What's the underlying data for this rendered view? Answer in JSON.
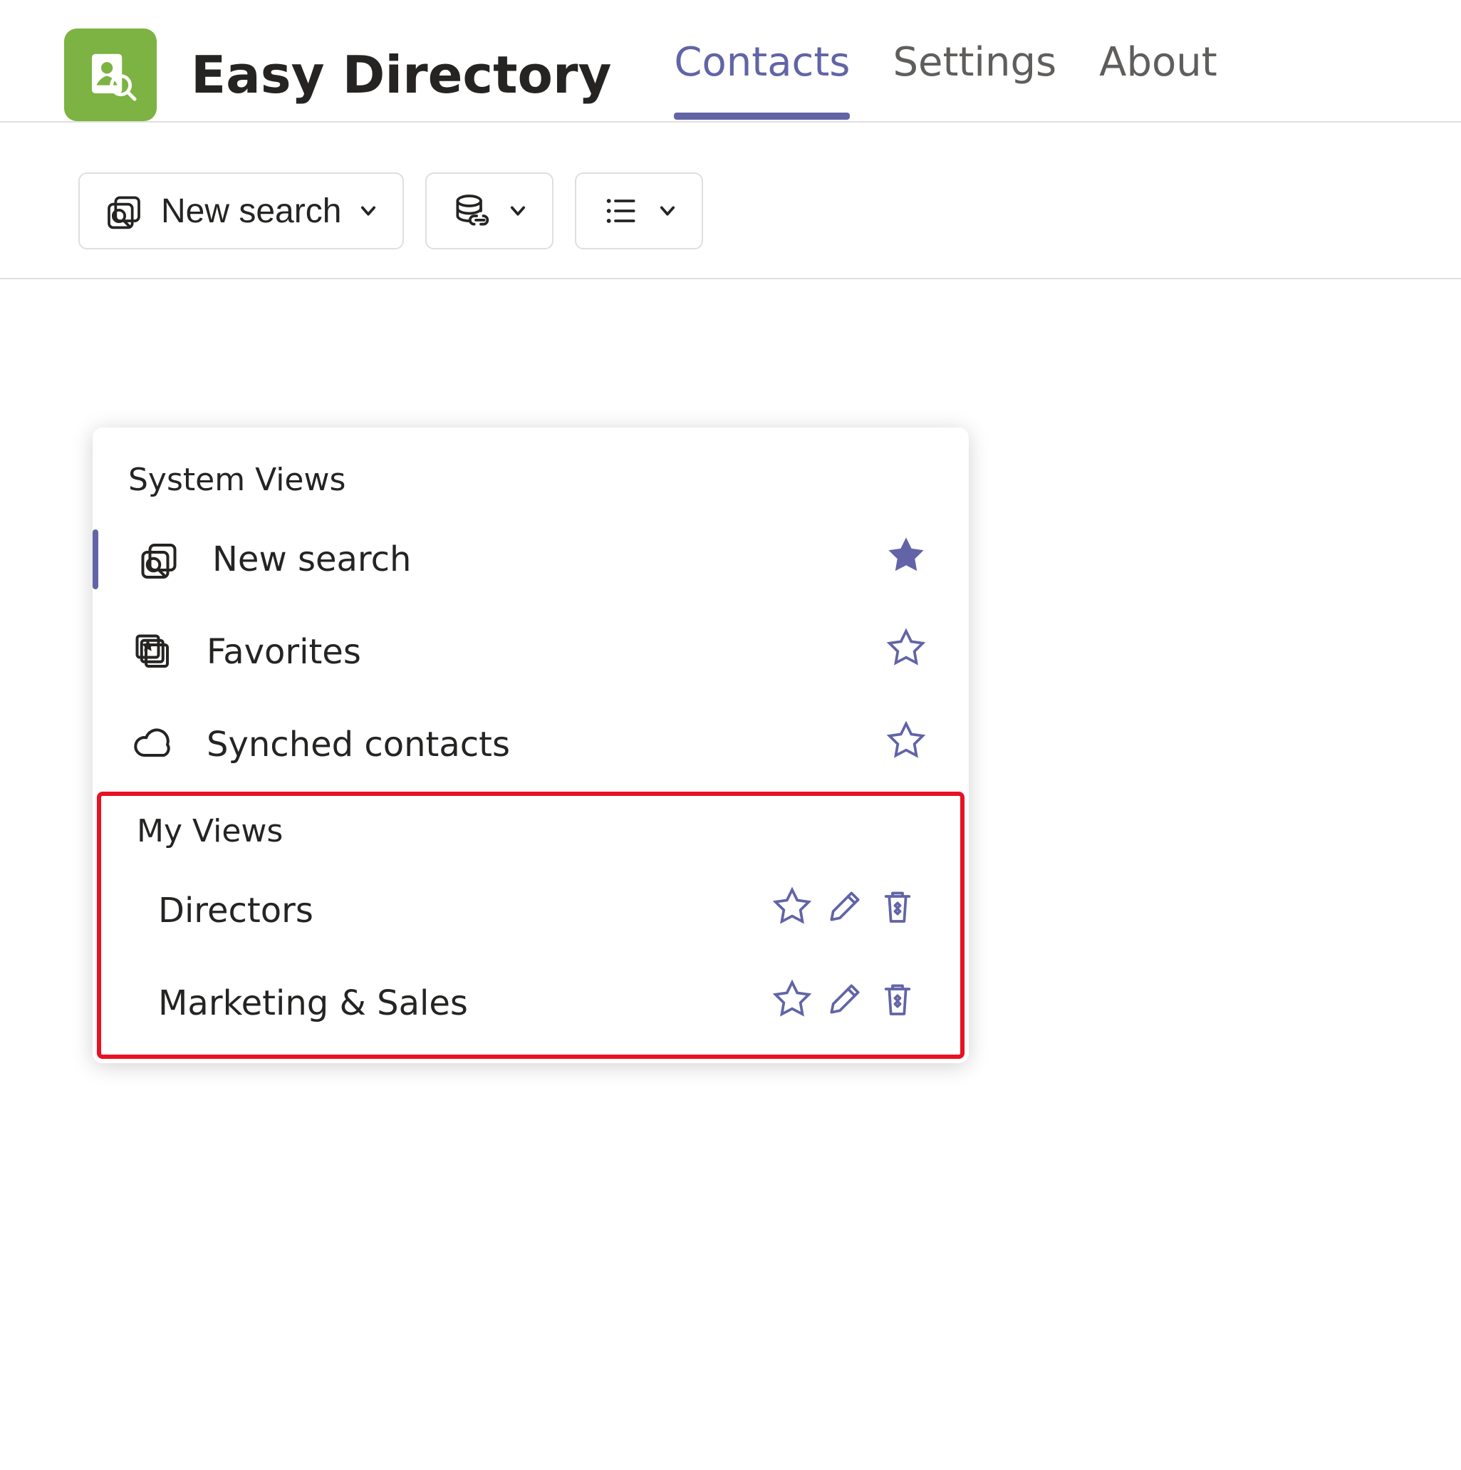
{
  "header": {
    "app_title": "Easy Directory",
    "tabs": [
      {
        "label": "Contacts",
        "active": true
      },
      {
        "label": "Settings",
        "active": false
      },
      {
        "label": "About",
        "active": false
      }
    ]
  },
  "toolbar": {
    "new_search_label": "New search"
  },
  "dropdown": {
    "system_views_label": "System Views",
    "system_views": [
      {
        "label": "New search",
        "icon": "search-window-icon",
        "starred": true,
        "selected": true
      },
      {
        "label": "Favorites",
        "icon": "favorites-stack-icon",
        "starred": false,
        "selected": false
      },
      {
        "label": "Synched contacts",
        "icon": "cloud-icon",
        "starred": false,
        "selected": false
      }
    ],
    "my_views_label": "My Views",
    "my_views": [
      {
        "label": "Directors"
      },
      {
        "label": "Marketing & Sales"
      }
    ]
  }
}
